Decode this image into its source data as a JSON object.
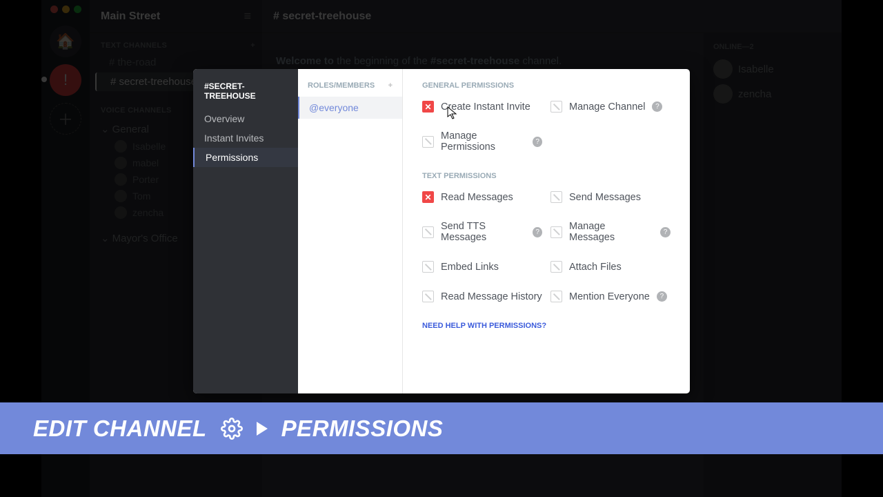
{
  "server": {
    "name": "Main Street"
  },
  "channels": {
    "text_header": "TEXT CHANNELS",
    "items": [
      {
        "name": "# the-road"
      },
      {
        "name": "# secret-treehouse"
      }
    ],
    "voice_header": "VOICE CHANNELS",
    "voice_cat": "General",
    "voice_users": [
      "Isabelle",
      "mabel",
      "Porter",
      "Tom",
      "zencha"
    ],
    "voice_cat2": "Mayor's Office"
  },
  "main": {
    "channel_title": "# secret-treehouse",
    "welcome_prefix": "Welcome to",
    "welcome_mid": " the beginning of the ",
    "welcome_chan": "#secret-treehouse",
    "welcome_suffix": " channel."
  },
  "members": {
    "header": "ONLINE—2",
    "list": [
      "Isabelle",
      "zencha"
    ]
  },
  "modal": {
    "title": "#SECRET-TREEHOUSE",
    "nav": {
      "overview": "Overview",
      "invites": "Instant Invites",
      "permissions": "Permissions"
    },
    "roles_header": "ROLES/MEMBERS",
    "role_everyone": "@everyone",
    "general_header": "GENERAL PERMISSIONS",
    "general": {
      "create_invite": "Create Instant Invite",
      "manage_channel": "Manage Channel",
      "manage_permissions": "Manage Permissions"
    },
    "text_header": "TEXT PERMISSIONS",
    "text": {
      "read_messages": "Read Messages",
      "send_messages": "Send Messages",
      "send_tts": "Send TTS Messages",
      "manage_messages": "Manage Messages",
      "embed_links": "Embed Links",
      "attach_files": "Attach Files",
      "read_history": "Read Message History",
      "mention_everyone": "Mention Everyone"
    },
    "help_link": "NEED HELP WITH PERMISSIONS?"
  },
  "banner": {
    "edit": "EDIT CHANNEL",
    "permissions": "PERMISSIONS"
  }
}
